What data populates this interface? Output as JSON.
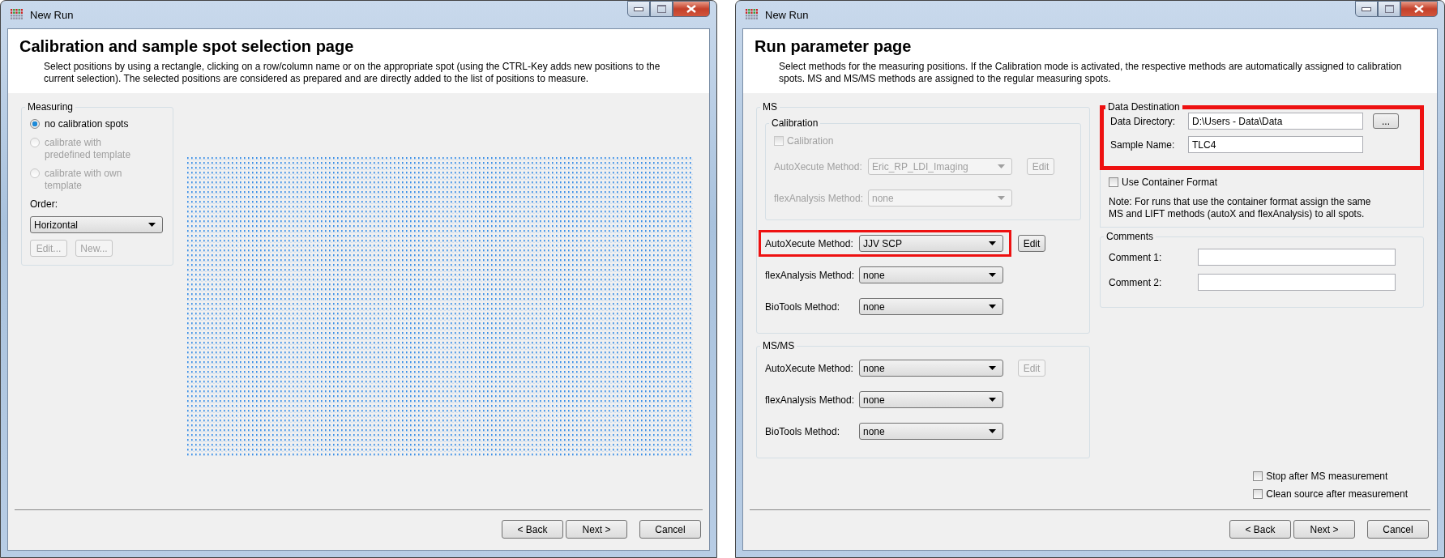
{
  "windows": [
    {
      "kind": "spot_selection",
      "title": "New Run",
      "heading": "Calibration and sample spot selection page",
      "description": "Select positions by using a rectangle, clicking on a row/column name or on the appropriate spot (using the CTRL-Key adds new positions to the current selection). The selected positions are considered as prepared and are directly added to the list of positions to measure.",
      "measuring": {
        "legend": "Measuring",
        "options": [
          {
            "label": "no calibration spots",
            "selected": true,
            "disabled": false
          },
          {
            "label": "calibrate with predefined template",
            "selected": false,
            "disabled": true
          },
          {
            "label": "calibrate with own template",
            "selected": false,
            "disabled": true
          }
        ],
        "order_label": "Order:",
        "order_value": "Horizontal",
        "buttons": [
          {
            "label": "Edit...",
            "disabled": true
          },
          {
            "label": "New...",
            "disabled": true
          }
        ]
      },
      "buttons": [
        "< Back",
        "Next >",
        "Cancel"
      ]
    },
    {
      "kind": "run_parameters",
      "title": "New Run",
      "heading": "Run parameter page",
      "description": "Select methods for the measuring positions. If the Calibration mode is activated, the respective methods are automatically assigned to calibration spots. MS and MS/MS methods are assigned to the regular measuring spots.",
      "ms": {
        "legend": "MS",
        "calibration": {
          "legend": "Calibration",
          "checkbox": {
            "label": "Calibration",
            "checked": false,
            "disabled": true
          },
          "rows": [
            {
              "label": "AutoXecute Method:",
              "value": "Eric_RP_LDI_Imaging",
              "disabled": true,
              "highlighted": false,
              "edit": {
                "label": "Edit",
                "disabled": true
              }
            },
            {
              "label": "flexAnalysis Method:",
              "value": "none",
              "disabled": true,
              "highlighted": false
            }
          ]
        },
        "rows": [
          {
            "label": "AutoXecute Method:",
            "value": "JJV SCP",
            "disabled": false,
            "highlighted": true,
            "edit": {
              "label": "Edit",
              "disabled": false
            }
          },
          {
            "label": "flexAnalysis Method:",
            "value": "none",
            "disabled": false,
            "highlighted": false
          },
          {
            "label": "BioTools Method:",
            "value": "none",
            "disabled": false,
            "highlighted": false
          }
        ]
      },
      "msms": {
        "legend": "MS/MS",
        "rows": [
          {
            "label": "AutoXecute Method:",
            "value": "none",
            "disabled": false,
            "highlighted": false,
            "edit": {
              "label": "Edit",
              "disabled": true
            }
          },
          {
            "label": "flexAnalysis Method:",
            "value": "none",
            "disabled": false,
            "highlighted": false
          },
          {
            "label": "BioTools Method:",
            "value": "none",
            "disabled": false,
            "highlighted": false
          }
        ]
      },
      "data_destination": {
        "legend": "Data Destination",
        "highlighted": true,
        "directory_label": "Data Directory:",
        "directory_value": "D:\\Users - Data\\Data",
        "browse_label": "...",
        "sample_label": "Sample Name:",
        "sample_value": "TLC4"
      },
      "container": {
        "label": "Use Container Format",
        "checked": false
      },
      "note": "Note: For runs that use the container format assign the same MS and LIFT methods (autoX and flexAnalysis) to all spots.",
      "comments": {
        "legend": "Comments",
        "fields": [
          {
            "label": "Comment 1:"
          },
          {
            "label": "Comment 2:"
          }
        ]
      },
      "options": [
        {
          "label": "Stop after MS measurement",
          "checked": false
        },
        {
          "label": "Clean source after measurement",
          "checked": false
        }
      ],
      "buttons": [
        "< Back",
        "Next >",
        "Cancel"
      ]
    }
  ]
}
